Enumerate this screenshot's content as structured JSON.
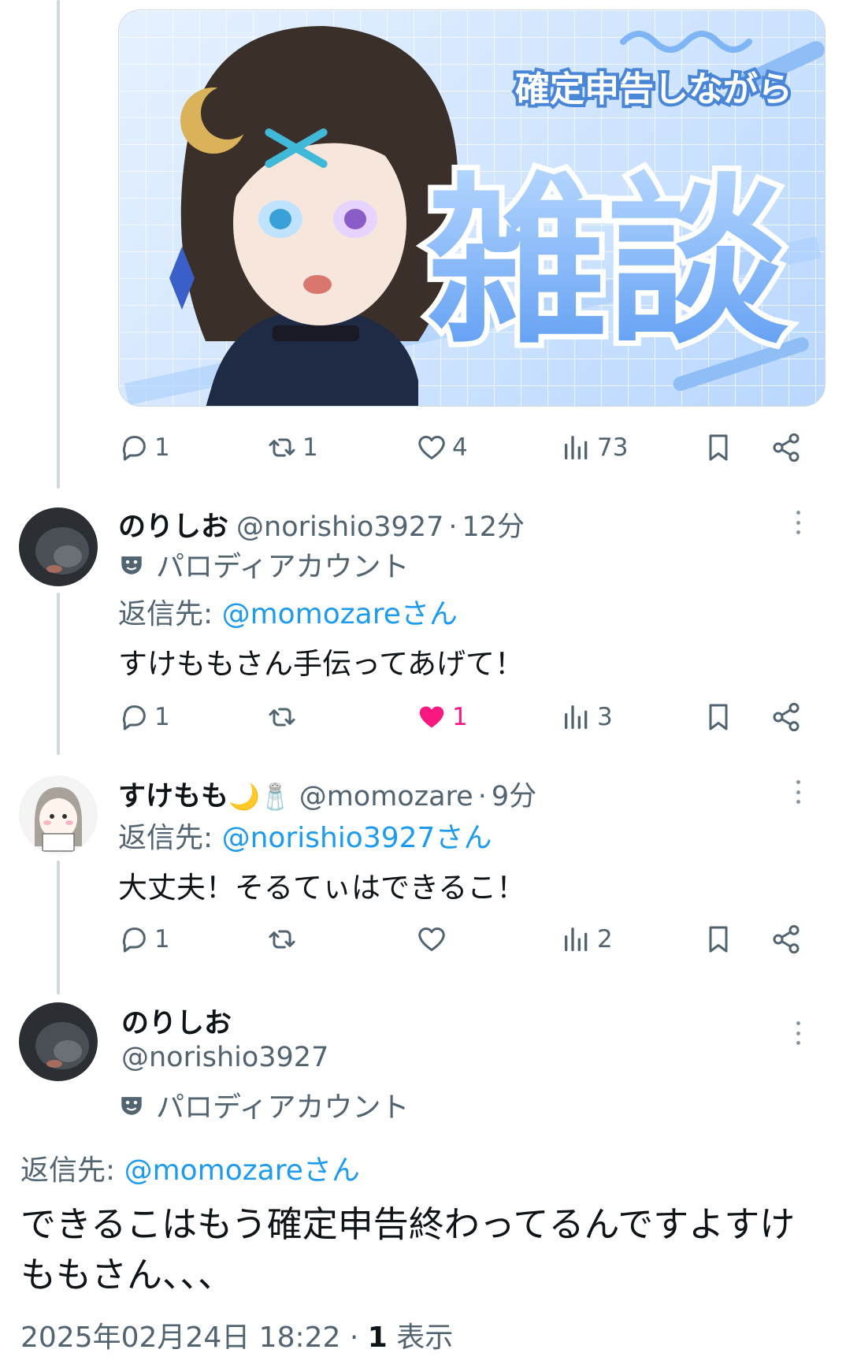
{
  "media_post": {
    "thumbnail": {
      "subtitle": "確定申告しながら",
      "title": "雑談"
    },
    "actions": {
      "replies": "1",
      "reposts": "1",
      "likes": "4",
      "views": "73"
    }
  },
  "reply1": {
    "display_name": "のりしお",
    "handle": "@norishio3927",
    "time": "12分",
    "label": "パロディアカウント",
    "reply_prefix": "返信先: ",
    "reply_mention": "@momozareさん",
    "text": "すけももさん手伝ってあげて！",
    "actions": {
      "replies": "1",
      "reposts": "",
      "likes": "1",
      "views": "3"
    }
  },
  "reply2": {
    "display_name": "すけもも",
    "name_emoji": "🌙🧂",
    "handle": "@momozare",
    "time": "9分",
    "reply_prefix": "返信先: ",
    "reply_mention": "@norishio3927さん",
    "text": "大丈夫！そるてぃはできるこ！",
    "actions": {
      "replies": "1",
      "reposts": "",
      "likes": "",
      "views": "2"
    }
  },
  "main_post": {
    "display_name": "のりしお",
    "handle": "@norishio3927",
    "label": "パロディアカウント",
    "reply_prefix": "返信先: ",
    "reply_mention": "@momozareさん",
    "text": "できるこはもう確定申告終わってるんですよすけももさん、、、",
    "timestamp": "2025年02月24日 18:22",
    "views_count": "1",
    "views_label": "表示"
  },
  "colors": {
    "accent": "#1d9bf0",
    "like": "#f91880",
    "muted": "#536471"
  }
}
